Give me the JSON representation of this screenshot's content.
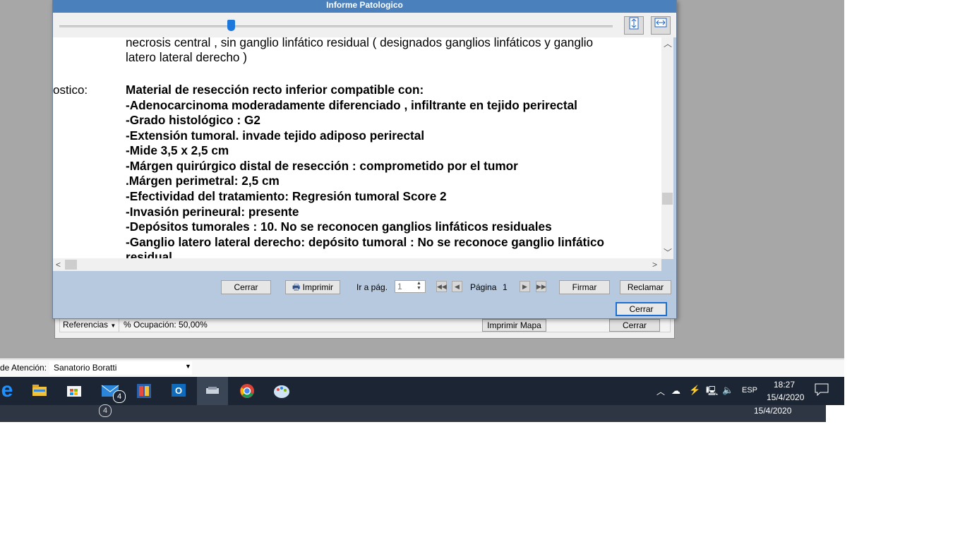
{
  "dialog": {
    "title": "Informe Patologico",
    "zoom_percent": 31
  },
  "document": {
    "label_partial": "ostico:",
    "lines": [
      "necrosis central , sin ganglio linfático residual ( designados ganglios linfáticos y ganglio",
      "latero lateral derecho )",
      "Material de resección recto inferior compatible con:",
      "-Adenocarcinoma moderadamente diferenciado , infiltrante en tejido perirectal",
      "-Grado histológico : G2",
      "-Extensión tumoral. invade tejido adiposo perirectal",
      "-Mide 3,5 x 2,5 cm",
      "-Márgen quirúrgico distal de resección : comprometido por el tumor",
      ".Márgen perimetral: 2,5 cm",
      "-Efectividad del tratamiento: Regresión tumoral Score 2",
      "-Invasión perineural: presente",
      "-Depósitos tumorales : 10. No se reconocen ganglios linfáticos residuales",
      "-Ganglio latero lateral derecho: depósito tumoral : No se reconoce ganglio linfático",
      "residual"
    ]
  },
  "footer": {
    "cerrar": "Cerrar",
    "imprimir": "Imprimir",
    "ir_a_pag": "Ir a pág.",
    "page_input": "1",
    "pagina_label": "Página",
    "pagina_num": "1",
    "firmar": "Firmar",
    "reclamar": "Reclamar",
    "cerrar2": "Cerrar"
  },
  "bg_window": {
    "referencias": "Referencias",
    "ocupacion": "% Ocupación: 50,00%",
    "imprimir_mapa": "Imprimir Mapa",
    "cerrar": "Cerrar"
  },
  "location": {
    "label": "de Atención:",
    "value": "Sanatorio Boratti"
  },
  "taskbar": {
    "mail_badge": "4",
    "lang": "ESP",
    "time": "18:27",
    "date": "15/4/2020",
    "date_dup": "15/4/2020",
    "mail_badge_dup": "4"
  },
  "colors": {
    "titlebar": "#4a81bd",
    "dialog_bg": "#b7c9df",
    "taskbar": "#1c2533",
    "accent": "#1a6fd0"
  }
}
